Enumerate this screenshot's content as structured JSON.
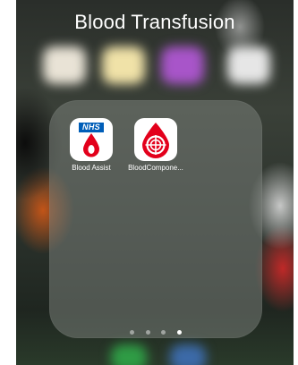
{
  "folder": {
    "title": "Blood Transfusion",
    "apps": [
      {
        "label": "Blood Assist",
        "badge": "NHS",
        "icon": "blood-drop-icon",
        "accent": "#e3001b",
        "badge_color": "#005eb8"
      },
      {
        "label": "BloodCompone...",
        "icon": "blood-component-icon",
        "accent": "#e3001b"
      }
    ],
    "pages": {
      "count": 4,
      "current": 4
    }
  }
}
